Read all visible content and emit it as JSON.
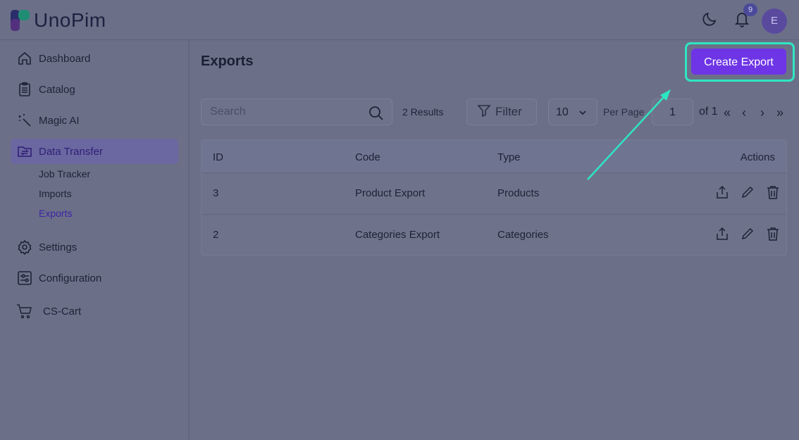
{
  "app": {
    "name": "UnoPim"
  },
  "header": {
    "notification_count": "9",
    "avatar_initial": "E"
  },
  "sidebar": {
    "items": [
      {
        "label": "Dashboard",
        "icon": "home-icon"
      },
      {
        "label": "Catalog",
        "icon": "clipboard-icon"
      },
      {
        "label": "Magic AI",
        "icon": "magic-wand-icon"
      },
      {
        "label": "Data Transfer",
        "icon": "folder-transfer-icon",
        "active": true
      },
      {
        "label": "Settings",
        "icon": "gear-icon"
      },
      {
        "label": "Configuration",
        "icon": "sliders-icon"
      },
      {
        "label": "CS-Cart",
        "icon": "cart-icon"
      }
    ],
    "subitems": [
      {
        "label": "Job Tracker"
      },
      {
        "label": "Imports"
      },
      {
        "label": "Exports",
        "active": true
      }
    ]
  },
  "main": {
    "title": "Exports",
    "create_button": "Create Export",
    "search": {
      "placeholder": "Search"
    },
    "results": "2 Results",
    "filter_label": "Filter",
    "per_page": {
      "value": "10",
      "label": "Per Page"
    },
    "pagination": {
      "current": "1",
      "of_label": "of 1",
      "first": "«",
      "prev": "‹",
      "next": "›",
      "last": "»"
    },
    "table": {
      "columns": [
        "ID",
        "Code",
        "Type",
        "Actions"
      ],
      "rows": [
        {
          "id": "3",
          "code": "Product Export",
          "type": "Products"
        },
        {
          "id": "2",
          "code": "Categories Export",
          "type": "Categories"
        }
      ]
    }
  },
  "colors": {
    "accent": "#6e35e6",
    "highlight": "#2ee6c2",
    "overlay": "#6b7088"
  }
}
